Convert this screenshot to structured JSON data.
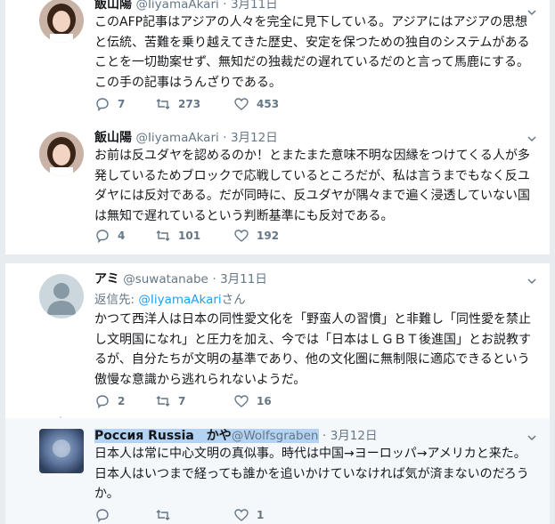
{
  "tweets": [
    {
      "name": "飯山陽",
      "handle": "@IiyamaAkari",
      "date": "3月11日",
      "text": "このAFP記事はアジアの人々を完全に見下している。アジアにはアジアの思想\nと伝統、苦難を乗り越えてきた歴史、安定を保つための独自のシステムがある\nことを一切勘案せず、無知だの独裁だの遅れているだのと言って馬鹿にする。\nこの手の記事はうんざりである。",
      "replies": "7",
      "retweets": "273",
      "likes": "453"
    },
    {
      "name": "飯山陽",
      "handle": "@IiyamaAkari",
      "date": "3月12日",
      "text": "お前は反ユダヤを認めるのか！とまたまた意味不明な因縁をつけてくる人が多\n発しているためブロックで応戦しているところだが、私は言うまでもなく反ユ\nダヤには反対である。だが同時に、反ユダヤが隅々まで遍く浸透していない国\nは無知で遅れているという判断基準にも反対である。",
      "replies": "4",
      "retweets": "101",
      "likes": "192"
    },
    {
      "name": "アミ",
      "handle": "@suwatanabe",
      "date": "3月11日",
      "reply_prefix": "返信先: ",
      "reply_link": "@IiyamaAkari",
      "reply_suffix": "さん",
      "text": "かつて西洋人は日本の同性愛文化を「野蛮人の習慣」と非難し「同性愛を禁止\nし文明国になれ」と圧力を加え、今では「日本はＬＧＢＴ後進国」とお説教す\nるが、自分たちが文明の基準であり、他の文化圏に無制限に適応できるという\n傲慢な意識から逃れられないようだ。",
      "replies": "2",
      "retweets": "7",
      "likes": "16"
    },
    {
      "name": "Россия Russia　かや",
      "handle": "@Wolfsgraben",
      "date": "3月12日",
      "text": "日本人は常に中心文明の真似事。時代は中国→ヨーロッパ→アメリカと来た。\n日本人はいつまで経っても誰かを追いかけていなければ気が済まないのだろう\nか。",
      "replies": "",
      "retweets": "",
      "likes": "1"
    }
  ],
  "separator_dot": "·",
  "colors": {
    "accent": "#1da1f2",
    "muted": "#657786",
    "thread": "#c4e5f7",
    "highlight": "#b4d3f2"
  },
  "icons": [
    "reply-icon",
    "retweet-icon",
    "like-icon",
    "caret-down-icon"
  ]
}
